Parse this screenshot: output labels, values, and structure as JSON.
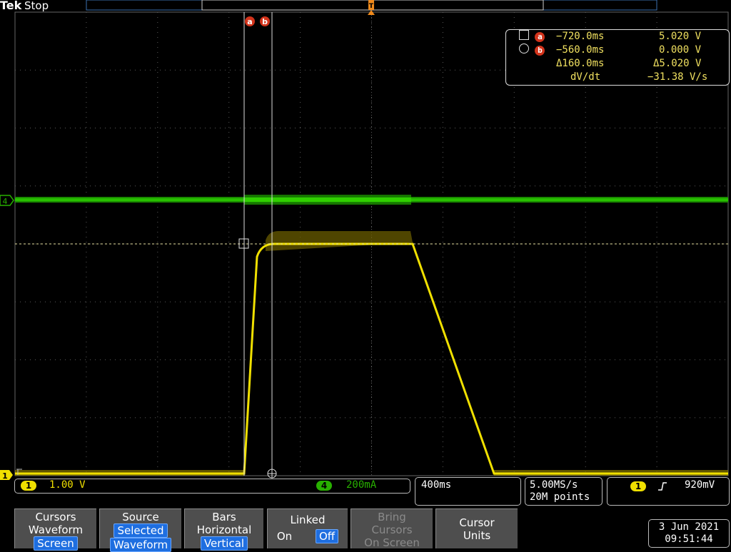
{
  "header": {
    "brand": "Tek",
    "run_state": "Stop"
  },
  "cursors": {
    "label_a": "a",
    "label_b": "b",
    "readout": {
      "a_time": "−720.0ms",
      "a_value": "5.020 V",
      "b_time": "−560.0ms",
      "b_value": "0.000 V",
      "delta_time": "Δ160.0ms",
      "delta_value": "Δ5.020 V",
      "rate_label": "dV/dt",
      "rate_value": "−31.38 V/s"
    }
  },
  "channels": {
    "ch1": {
      "number": "1",
      "scale": "1.00 V",
      "color": "#f0e000",
      "marker": "1"
    },
    "ch4": {
      "number": "4",
      "scale": "200mA",
      "color": "#28b000",
      "marker": "4"
    }
  },
  "timebase": {
    "scale": "400ms",
    "sample_rate": "5.00MS/s",
    "record_length": "20M points"
  },
  "trigger": {
    "source": "1",
    "level": "920mV",
    "slope_icon": "rising-edge-icon",
    "marker": "T"
  },
  "softkeys": [
    {
      "line1": "Cursors",
      "line2": "Waveform",
      "selected": "Screen"
    },
    {
      "line1": "Source",
      "line2": "Selected",
      "selected": "Waveform"
    },
    {
      "line1": "Bars",
      "line2": "Horizontal",
      "selected": "Vertical"
    },
    {
      "line1": "Linked",
      "opt_on": "On",
      "opt_off": "Off"
    },
    {
      "line1": "Bring",
      "line2": "Cursors",
      "line3": "On Screen"
    },
    {
      "line1": "Cursor",
      "line2": "Units"
    }
  ],
  "datetime": {
    "date": "3 Jun 2021",
    "time": "09:51:44"
  },
  "colors": {
    "ch1": "#f0e000",
    "ch4": "#28b000",
    "cursor_badge": "#d2331b",
    "trigger_marker": "#f08a1c",
    "selected_key": "#1e6ee0"
  }
}
